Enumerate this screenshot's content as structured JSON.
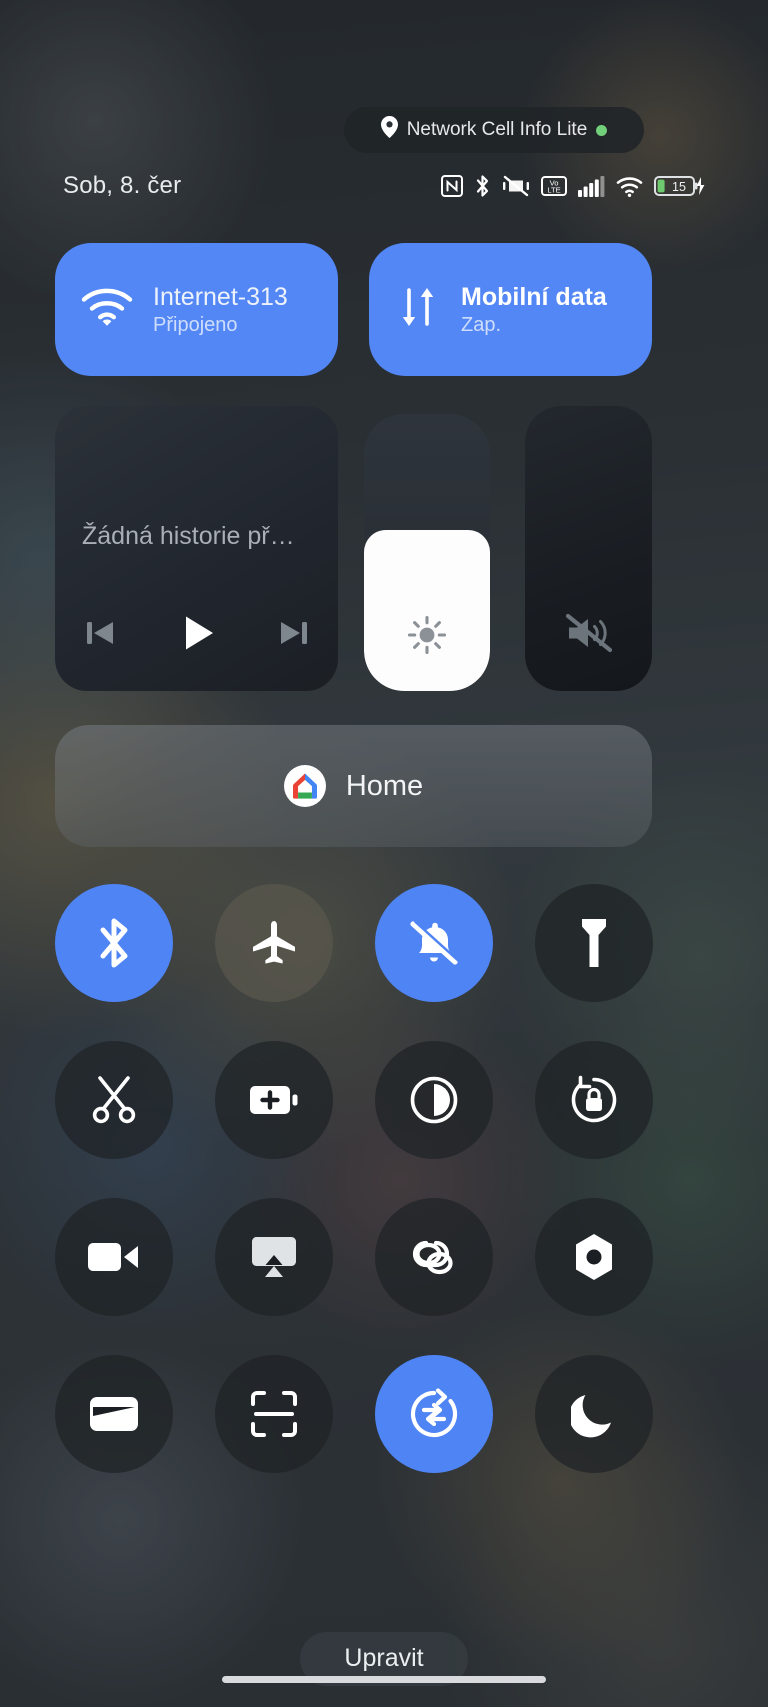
{
  "privacy_chip": {
    "icon": "location-pin-icon",
    "label": "Network Cell Info Lite",
    "indicator_color": "#72d07a"
  },
  "status_bar": {
    "date": "Sob, 8. čer",
    "battery_level": "15",
    "icons": [
      "nfc-icon",
      "bluetooth-icon",
      "vibrate-off-icon",
      "volte-icon",
      "cellular-signal-icon",
      "wifi-icon",
      "battery-charging-icon"
    ]
  },
  "internet_tiles": [
    {
      "name": "wifi-tile",
      "title": "Internet-313",
      "subtitle": "Připojeno",
      "icon": "wifi-icon",
      "active": true
    },
    {
      "name": "mobile-data-tile",
      "title": "Mobilní data",
      "subtitle": "Zap.",
      "icon": "data-transfer-icon",
      "active": true
    }
  ],
  "media_player": {
    "title": "Žádná historie př…",
    "controls": [
      "previous-icon",
      "play-icon",
      "next-icon"
    ]
  },
  "brightness": {
    "icon": "brightness-icon",
    "level_percent": 58
  },
  "volume": {
    "icon": "volume-muted-icon"
  },
  "home_controls": {
    "label": "Home",
    "icon": "google-home-icon"
  },
  "quick_tiles": [
    {
      "name": "tile-bluetooth",
      "icon": "bluetooth-icon",
      "state": "on"
    },
    {
      "name": "tile-airplane",
      "icon": "airplane-icon",
      "state": "dim"
    },
    {
      "name": "tile-dnd",
      "icon": "bell-off-icon",
      "state": "on"
    },
    {
      "name": "tile-flashlight",
      "icon": "flashlight-icon",
      "state": "off"
    },
    {
      "name": "tile-screenshot",
      "icon": "scissors-icon",
      "state": "off"
    },
    {
      "name": "tile-battery-saver",
      "icon": "battery-plus-icon",
      "state": "off"
    },
    {
      "name": "tile-dark-theme",
      "icon": "contrast-icon",
      "state": "off"
    },
    {
      "name": "tile-rotation-lock",
      "icon": "rotation-lock-icon",
      "state": "off"
    },
    {
      "name": "tile-screen-record",
      "icon": "video-camera-icon",
      "state": "off"
    },
    {
      "name": "tile-cast",
      "icon": "cast-icon",
      "state": "off"
    },
    {
      "name": "tile-nearby-share",
      "icon": "nearby-share-icon",
      "state": "off"
    },
    {
      "name": "tile-hotspot",
      "icon": "hotspot-icon",
      "state": "off"
    },
    {
      "name": "tile-wallet",
      "icon": "wallet-icon",
      "state": "off"
    },
    {
      "name": "tile-qr-scanner",
      "icon": "qr-scanner-icon",
      "state": "off"
    },
    {
      "name": "tile-data-saver",
      "icon": "data-saver-icon",
      "state": "on"
    },
    {
      "name": "tile-night-light",
      "icon": "moon-icon",
      "state": "off"
    }
  ],
  "footer": {
    "edit_label": "Upravit"
  },
  "colors": {
    "accent": "#5287f5",
    "tile_on": "#4f84f5",
    "tile_off": "#1e2226",
    "text_primary": "#eceff1",
    "text_secondary": "#a9afb5",
    "indicator_green": "#72d07a"
  }
}
